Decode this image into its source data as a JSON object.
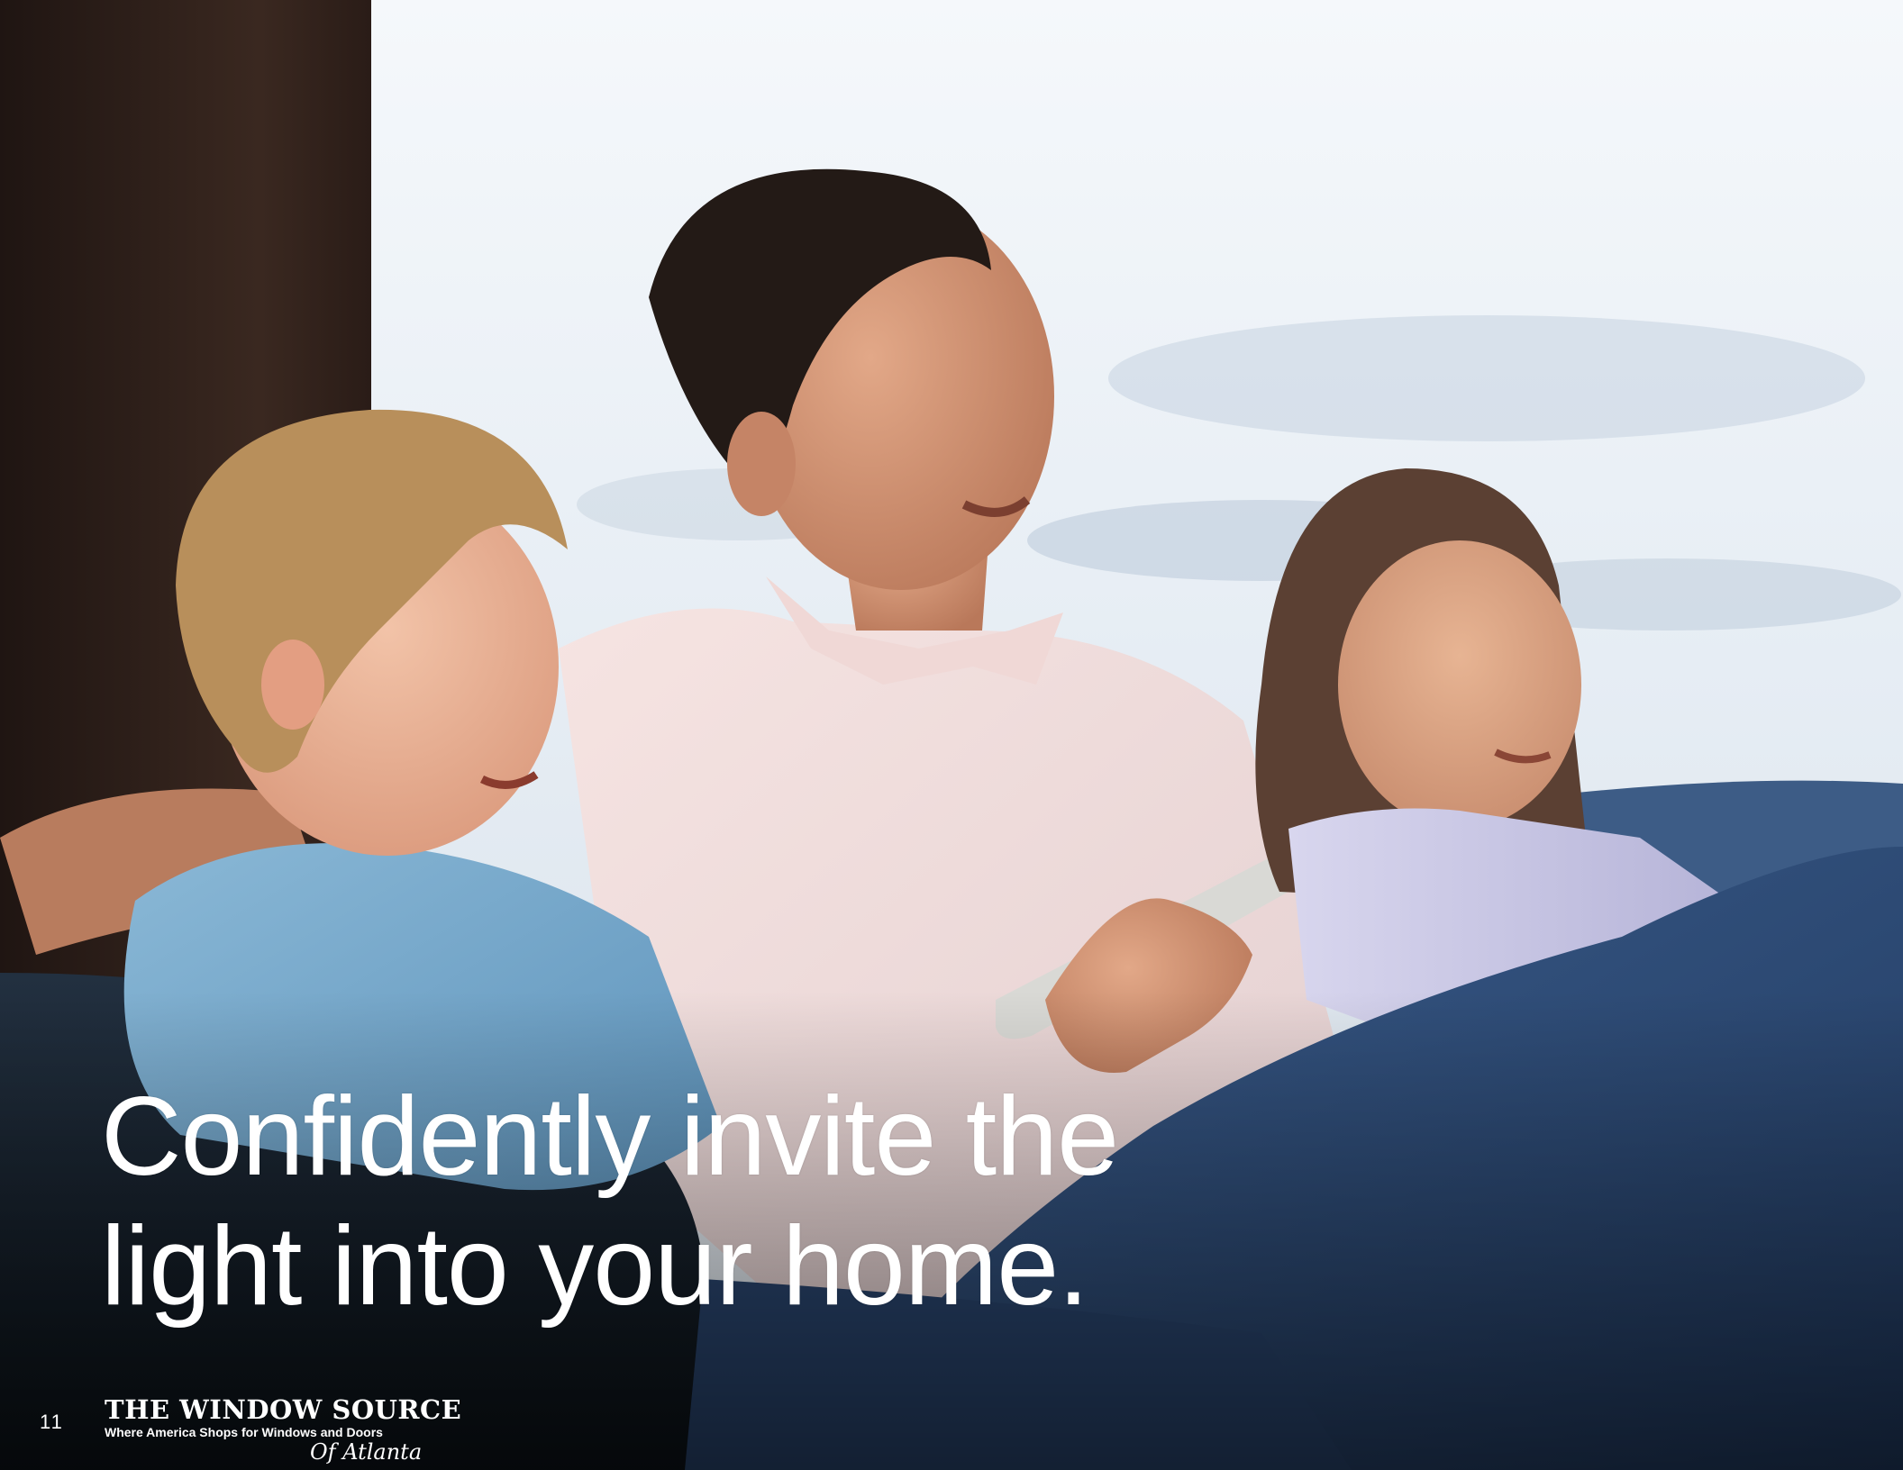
{
  "page": {
    "headline_line1": "Confidently invite the",
    "headline_line2": "light into your home.",
    "page_number": "11"
  },
  "logo": {
    "brand": "THE WINDOW SOURCE",
    "tagline": "Where America Shops for Windows and Doors",
    "city": "Of Atlanta"
  },
  "photo": {
    "subject": "father-and-two-children-watching-tv-on-couch",
    "icon": "family-photo"
  },
  "colors": {
    "headline_text": "#ffffff",
    "wall": "#2a1d18",
    "sky": "#e8eef5",
    "couch": "#16202c",
    "jeans": "#2e4c78"
  }
}
